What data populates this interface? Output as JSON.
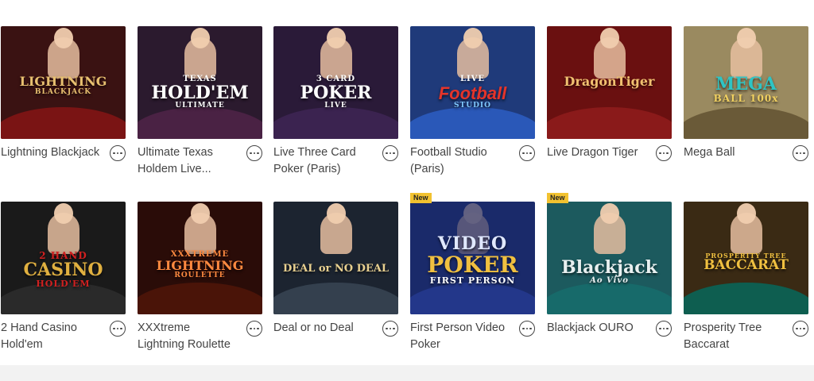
{
  "games": [
    {
      "title": "Lightning Blackjack",
      "logo": [
        "",
        "LIGHTNING",
        "BLACKJACK"
      ],
      "bg": "#3a1212",
      "accent": "#b5892f",
      "table": "#7a1414",
      "badge": ""
    },
    {
      "title": "Ultimate Texas Holdem Live...",
      "logo": [
        "TEXAS",
        "HOLD'EM",
        "ULTIMATE"
      ],
      "bg": "#2b1a2e",
      "accent": "#ffffff",
      "table": "#4a2244",
      "badge": ""
    },
    {
      "title": "Live Three Card Poker (Paris)",
      "logo": [
        "3 CARD",
        "POKER",
        "LIVE"
      ],
      "bg": "#2a1a38",
      "accent": "#ffffff",
      "table": "#3b2350",
      "badge": ""
    },
    {
      "title": "Football Studio (Paris)",
      "logo": [
        "LIVE",
        "Football",
        "STUDIO"
      ],
      "bg": "#1f3a7a",
      "accent": "#e4342a",
      "table": "#2a58b8",
      "badge": ""
    },
    {
      "title": "Live Dragon Tiger",
      "logo": [
        "",
        "DragonTiger",
        ""
      ],
      "bg": "#6a1010",
      "accent": "#f0c070",
      "table": "#8a1a1a",
      "badge": ""
    },
    {
      "title": "Mega Ball",
      "logo": [
        "",
        "MEGA",
        "BALL 100x"
      ],
      "bg": "#9a8a60",
      "accent": "#2ec4c4",
      "table": "#6a5a38",
      "badge": ""
    },
    {
      "title": "2 Hand Casino Hold'em",
      "logo": [
        "2 HAND",
        "CASINO",
        "HOLD'EM"
      ],
      "bg": "#1a1a1a",
      "accent": "#e0b040",
      "table": "#2a2a2a",
      "badge": ""
    },
    {
      "title": "XXXtreme Lightning Roulette",
      "logo": [
        "XXXTREME",
        "LIGHTNING",
        "ROULETTE"
      ],
      "bg": "#2a0c08",
      "accent": "#ff6a20",
      "table": "#4a1408",
      "badge": ""
    },
    {
      "title": "Deal or no Deal",
      "logo": [
        "",
        "DEAL or NO DEAL",
        ""
      ],
      "bg": "#1c2430",
      "accent": "#e8d090",
      "table": "#34404e",
      "badge": ""
    },
    {
      "title": "First Person Video Poker",
      "logo": [
        "VIDEO",
        "POKER",
        "FIRST PERSON"
      ],
      "bg": "#1a2a6a",
      "accent": "#f0c040",
      "table": "#23378a",
      "badge": "New"
    },
    {
      "title": "Blackjack OURO",
      "logo": [
        "",
        "Blackjack",
        "Ao Vivo"
      ],
      "bg": "#1c5a5e",
      "accent": "#e8f0f0",
      "table": "#176a6a",
      "badge": "New"
    },
    {
      "title": "Prosperity Tree Baccarat",
      "logo": [
        "PROSPERITY TREE",
        "BACCARAT",
        ""
      ],
      "bg": "#3a2a14",
      "accent": "#f0c040",
      "table": "#0e5e50",
      "badge": ""
    }
  ]
}
